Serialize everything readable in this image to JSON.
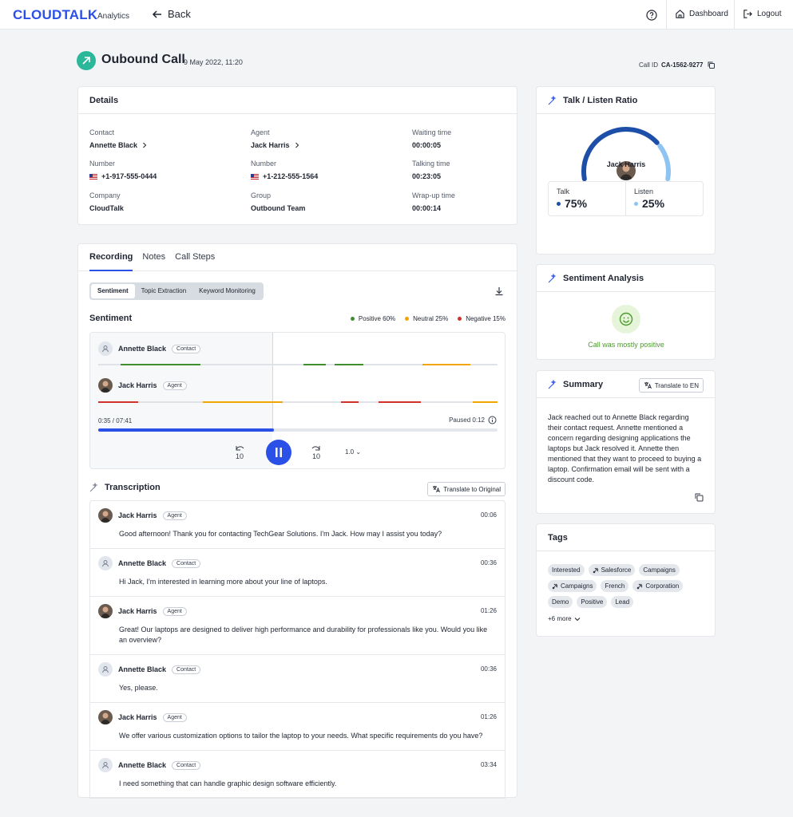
{
  "topbar": {
    "logo": "CLOUDTALK",
    "logo_sub": "Analytics",
    "back_label": "Back",
    "dashboard_label": "Dashboard",
    "logout_label": "Logout"
  },
  "header": {
    "title": "Oubound Call",
    "date": "9 May 2022, 11:20",
    "call_id_label": "Call ID",
    "call_id": "CA-1562-9277"
  },
  "details": {
    "title": "Details",
    "contact_label": "Contact",
    "contact": "Annette Black",
    "agent_label": "Agent",
    "agent": "Jack Harris",
    "waiting_label": "Waiting time",
    "waiting": "00:00:05",
    "number_label": "Number",
    "contact_number": "+1-917-555-0444",
    "agent_number_label": "Number",
    "agent_number": "+1-212-555-1564",
    "talking_label": "Talking time",
    "talking": "00:23:05",
    "company_label": "Company",
    "company": "CloudTalk",
    "group_label": "Group",
    "group": "Outbound Team",
    "wrap_label": "Wrap-up time",
    "wrap": "00:00:14"
  },
  "recording": {
    "tabs": [
      "Recording",
      "Notes",
      "Call Steps"
    ],
    "segments": [
      "Sentiment",
      "Topic Extraction",
      "Keyword Monitoring"
    ],
    "sentiment_title": "Sentiment",
    "legend": [
      {
        "label": "Positive 60%",
        "color": "#3f8f2f"
      },
      {
        "label": "Neutral 25%",
        "color": "#f0a500"
      },
      {
        "label": "Negative 15%",
        "color": "#d0312d"
      }
    ],
    "speaker1": {
      "name": "Annette Black",
      "role": "Contact"
    },
    "speaker2": {
      "name": "Jack Harris",
      "role": "Agent"
    },
    "time": "0:35 / 07:41",
    "paused": "Paused 0:12",
    "progress": 0.44,
    "skip_back": "10",
    "skip_fwd": "10",
    "speed": "1.0"
  },
  "transcription": {
    "title": "Transcription",
    "translate_label": "Translate to Original",
    "items": [
      {
        "name": "Jack Harris",
        "role": "Agent",
        "time": "00:06",
        "text": "Good afternoon! Thank you for contacting TechGear Solutions. I'm Jack. How may I assist you today?"
      },
      {
        "name": "Annette Black",
        "role": "Contact",
        "time": "00:36",
        "text": "Hi Jack, I'm interested in learning more about your line of laptops."
      },
      {
        "name": "Jack Harris",
        "role": "Agent",
        "time": "01:26",
        "text": "Great! Our laptops are designed to deliver high performance and durability for professionals like you. Would you like an overview?"
      },
      {
        "name": "Annette Black",
        "role": "Contact",
        "time": "00:36",
        "text": "Yes, please."
      },
      {
        "name": "Jack Harris",
        "role": "Agent",
        "time": "01:26",
        "text": "We offer various customization options to tailor the laptop to your needs. What specific requirements do you have?"
      },
      {
        "name": "Annette Black",
        "role": "Contact",
        "time": "03:34",
        "text": "I need something that can handle graphic design software efficiently."
      }
    ]
  },
  "ratio": {
    "title": "Talk / Listen Ratio",
    "name": "Jack Harris",
    "talk_label": "Talk",
    "talk": "75%",
    "listen_label": "Listen",
    "listen": "25%",
    "talk_fraction": 0.75,
    "talk_color": "#1e4fa8",
    "listen_color": "#8ec3f2"
  },
  "sentiment_card": {
    "title": "Sentiment Analysis",
    "caption": "Call was mostly positive"
  },
  "summary": {
    "title": "Summary",
    "translate_label": "Translate to EN",
    "text": "Jack reached out to Annette Black regarding their contact request. Annette mentioned a concern regarding designing applications the laptops but Jack resolved it. Annette then mentioned that they want to proceed to buying a laptop. Confirmation email will be sent with a discount code."
  },
  "tags": {
    "title": "Tags",
    "items": [
      {
        "label": "Interested",
        "integration": false
      },
      {
        "label": "Salesforce",
        "integration": true
      },
      {
        "label": "Campaigns",
        "integration": false
      },
      {
        "label": "Campaigns",
        "integration": true
      },
      {
        "label": "French",
        "integration": false
      },
      {
        "label": "Corporation",
        "integration": true
      },
      {
        "label": "Demo",
        "integration": false
      },
      {
        "label": "Positive",
        "integration": false
      },
      {
        "label": "Lead",
        "integration": false
      }
    ],
    "more": "+6 more"
  }
}
